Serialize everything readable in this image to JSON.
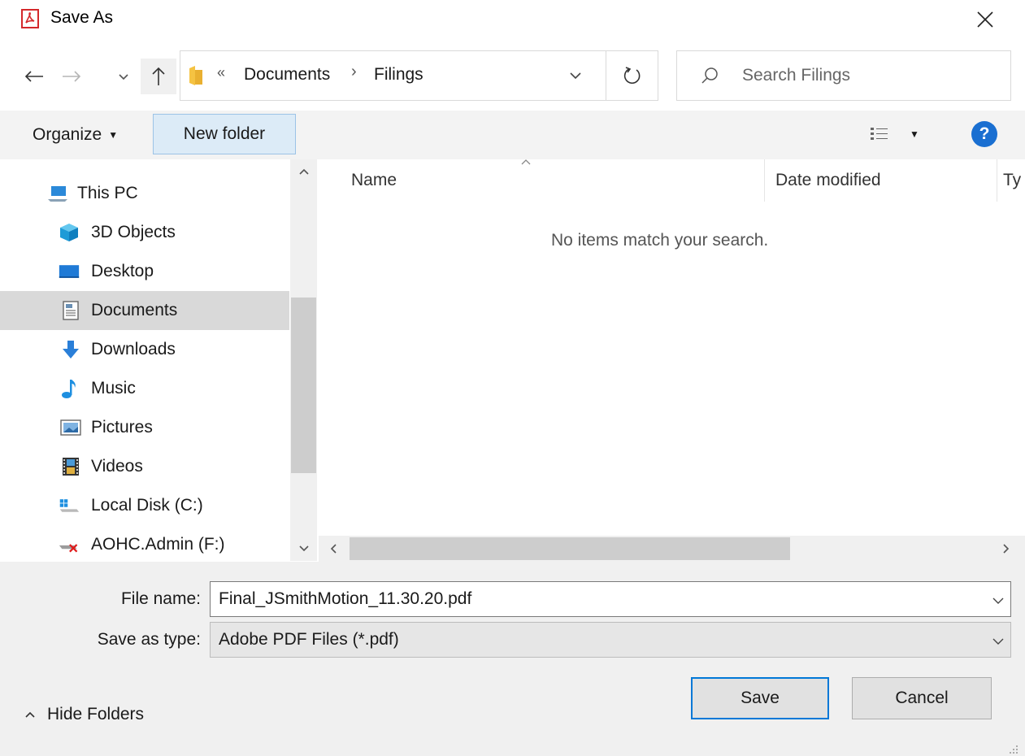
{
  "window": {
    "title": "Save As"
  },
  "address": {
    "overflow": "«",
    "crumbs": [
      "Documents",
      "Filings"
    ],
    "separator": "›"
  },
  "search": {
    "placeholder": "Search Filings"
  },
  "toolbar": {
    "organize_label": "Organize",
    "new_folder_label": "New folder",
    "help_label": "?"
  },
  "nav": {
    "items": [
      {
        "label": "This PC",
        "icon": "computer-icon"
      },
      {
        "label": "3D Objects",
        "icon": "cube-icon"
      },
      {
        "label": "Desktop",
        "icon": "desktop-icon"
      },
      {
        "label": "Documents",
        "icon": "documents-icon",
        "selected": true
      },
      {
        "label": "Downloads",
        "icon": "download-arrow-icon"
      },
      {
        "label": "Music",
        "icon": "music-note-icon"
      },
      {
        "label": "Pictures",
        "icon": "pictures-icon"
      },
      {
        "label": "Videos",
        "icon": "film-icon"
      },
      {
        "label": "Local Disk (C:)",
        "icon": "windows-drive-icon"
      },
      {
        "label": "AOHC.Admin (F:)",
        "icon": "disconnected-drive-icon"
      }
    ]
  },
  "filelist": {
    "columns": [
      "Name",
      "Date modified",
      "Ty"
    ],
    "empty_message": "No items match your search."
  },
  "form": {
    "file_name_label": "File name:",
    "file_name_value": "Final_JSmithMotion_11.30.20.pdf",
    "save_type_label": "Save as type:",
    "save_type_value": "Adobe PDF Files (*.pdf)"
  },
  "footer": {
    "hide_folders_label": "Hide Folders",
    "save_label": "Save",
    "cancel_label": "Cancel"
  },
  "colors": {
    "accent": "#0078d7",
    "selected_bg": "#d9d9d9",
    "new_folder_bg": "#dcebf7",
    "help_blue": "#1a6fd1"
  }
}
